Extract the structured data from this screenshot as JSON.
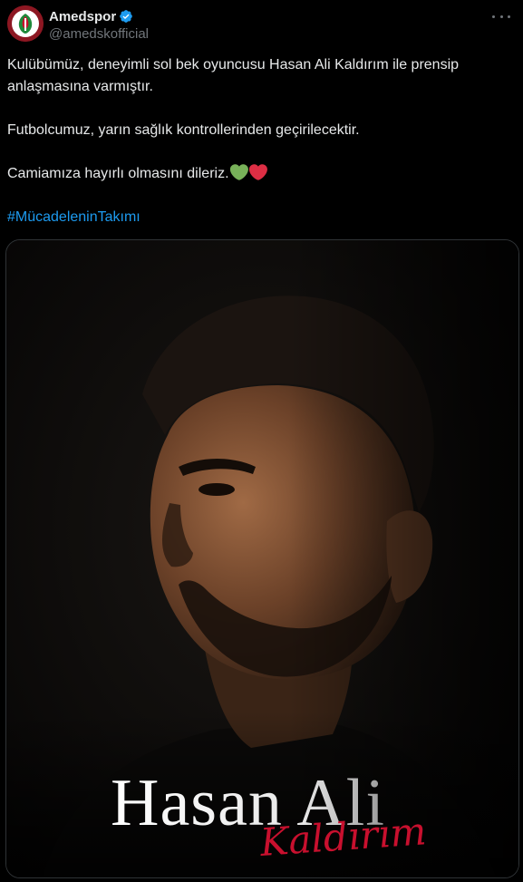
{
  "author": {
    "display_name": "Amedspor",
    "handle": "@amedskofficial",
    "verified_icon": "verified-badge-icon",
    "avatar_icon": "amedspor-crest-icon"
  },
  "menu": {
    "icon": "more-dots-icon"
  },
  "tweet": {
    "paragraph1": "Kulübümüz, deneyimli sol bek oyuncusu Hasan Ali Kaldırım ile prensip anlaşmasına varmıştır.",
    "paragraph2": "Futbolcumuz, yarın sağlık kontrollerinden geçirilecektir.",
    "paragraph3": "Camiamıza hayırlı olmasını dileriz.",
    "emoji1": "green-heart-icon",
    "emoji2": "red-heart-icon",
    "hashtag": "#MücadeleninTakımı"
  },
  "media": {
    "first_name": "Hasan Ali",
    "last_name": "Kaldırım"
  },
  "colors": {
    "background": "#000000",
    "text": "#e7e9ea",
    "secondary": "#71767b",
    "link": "#1d9bf0",
    "verified": "#1d9bf0",
    "accent_red": "#c8102e",
    "green_heart": "#78b159",
    "red_heart": "#dd2e44"
  }
}
